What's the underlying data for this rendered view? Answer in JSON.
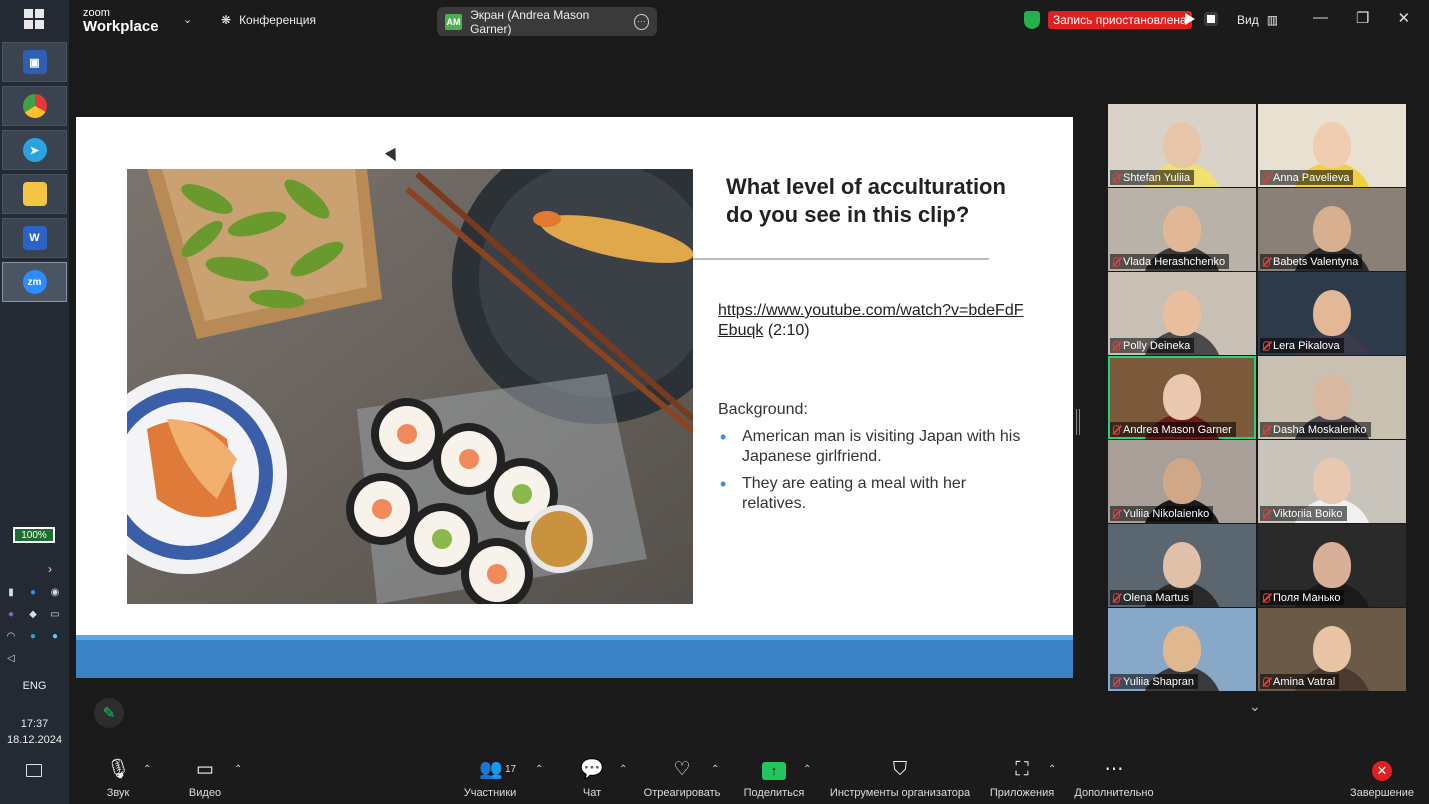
{
  "taskbar": {
    "battery": "100%",
    "language": "ENG",
    "time": "17:37",
    "date": "18.12.2024",
    "apps": [
      "save-app",
      "chrome",
      "telegram",
      "file-explorer",
      "word",
      "zoom"
    ],
    "active_app_label": "zm"
  },
  "topbar": {
    "logo_line1": "zoom",
    "logo_line2": "Workplace",
    "conference_label": "Конференция",
    "screen_share_initials": "AM",
    "screen_share_label": "Экран (Andrea Mason Garner)",
    "recording_status": "Запись приостановлена",
    "view_label": "Вид",
    "accent_record": "#e02020",
    "accent_shield": "#22b14c"
  },
  "slide": {
    "title": "What level of acculturation do you see in this clip?",
    "link": "https://www.youtube.com/watch?v=bdeFdFEbuqk",
    "link_suffix": "(2:10)",
    "background_label": "Background:",
    "bullets": [
      "American man is visiting Japan with his Japanese girlfriend.",
      "They are eating a meal with her relatives."
    ]
  },
  "gallery": {
    "participants": [
      "Shtefan Yuliia",
      "Anna Pavelieva",
      "Vlada Herashchenko",
      "Babets Valentyna",
      "Polly Deineka",
      "Lera Pikalova",
      "Andrea Mason Garner",
      "Dasha Moskalenko",
      "Yuliia Nikolaienko",
      "Viktoriia Boiko",
      "Olena Martus",
      "Поля Манько",
      "Yuliia Shapran",
      "Amina Vatral"
    ],
    "active_speaker": "Andrea Mason Garner",
    "speaker_color": "#27d07a"
  },
  "toolbar": {
    "audio": "Звук",
    "video": "Видео",
    "participants": "Участники",
    "participants_count": "17",
    "chat": "Чат",
    "react": "Отреагировать",
    "share": "Поделиться",
    "host_tools": "Инструменты организатора",
    "apps": "Приложения",
    "more": "Дополнительно",
    "end": "Завершение"
  }
}
